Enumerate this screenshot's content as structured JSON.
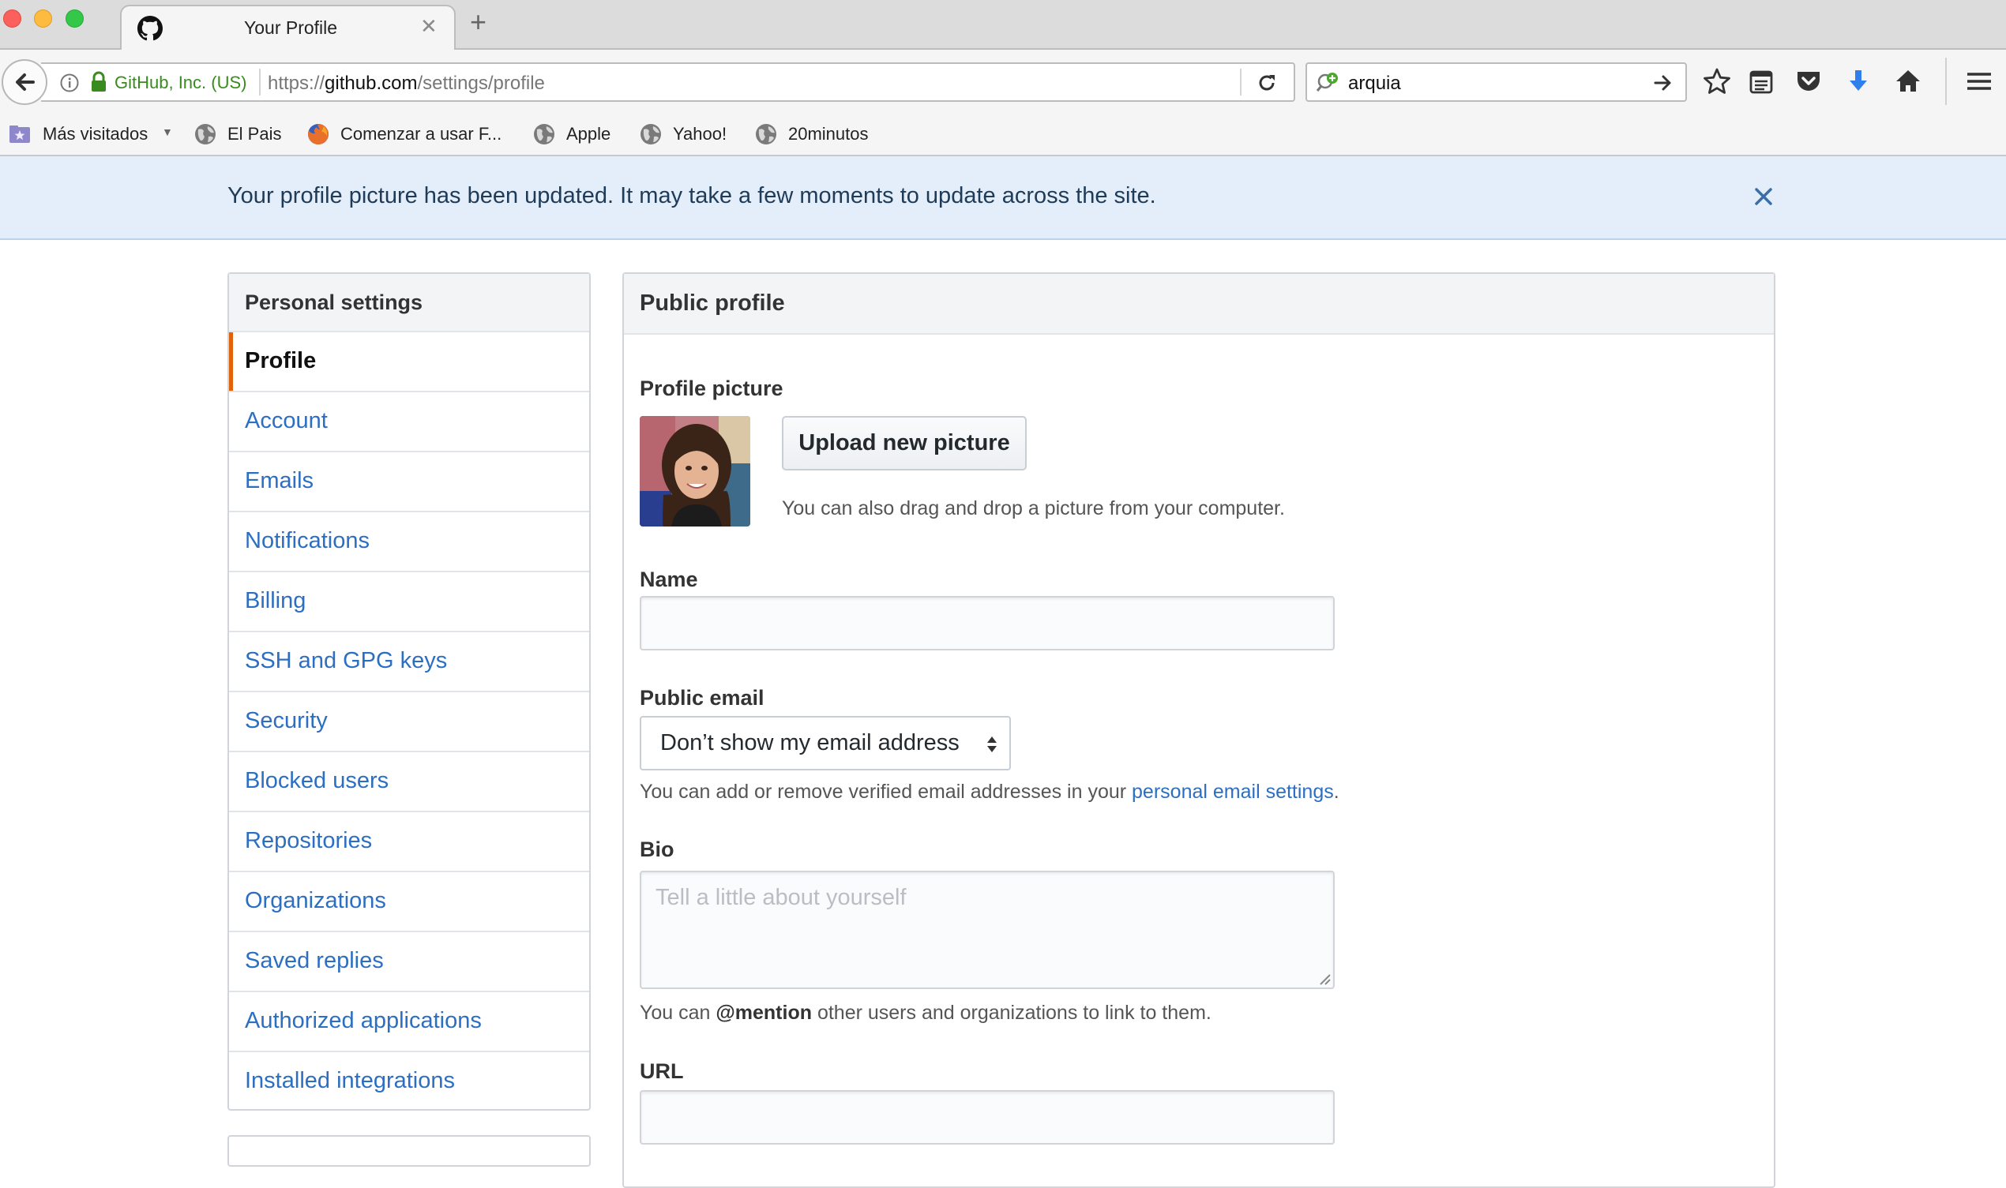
{
  "browser": {
    "tab_title": "Your Profile",
    "identity": "GitHub, Inc. (US)",
    "url_prefix": "https://",
    "url_host": "github.com",
    "url_path": "/settings/profile",
    "search_value": "arquia",
    "bookmarks": [
      {
        "label": "Más visitados",
        "icon": "most-visited-folder-icon"
      },
      {
        "label": "El Pais",
        "icon": "globe-icon"
      },
      {
        "label": "Comenzar a usar F...",
        "icon": "firefox-icon"
      },
      {
        "label": "Apple",
        "icon": "globe-icon"
      },
      {
        "label": "Yahoo!",
        "icon": "globe-icon"
      },
      {
        "label": "20minutos",
        "icon": "globe-icon"
      }
    ]
  },
  "flash": {
    "message": "Your profile picture has been updated. It may take a few moments to update across the site."
  },
  "sidebar": {
    "header": "Personal settings",
    "items": [
      {
        "label": "Profile",
        "selected": true
      },
      {
        "label": "Account"
      },
      {
        "label": "Emails"
      },
      {
        "label": "Notifications"
      },
      {
        "label": "Billing"
      },
      {
        "label": "SSH and GPG keys"
      },
      {
        "label": "Security"
      },
      {
        "label": "Blocked users"
      },
      {
        "label": "Repositories"
      },
      {
        "label": "Organizations"
      },
      {
        "label": "Saved replies"
      },
      {
        "label": "Authorized applications"
      },
      {
        "label": "Installed integrations"
      }
    ]
  },
  "profile": {
    "header": "Public profile",
    "picture_label": "Profile picture",
    "upload_button": "Upload new picture",
    "upload_note": "You can also drag and drop a picture from your computer.",
    "name_label": "Name",
    "name_value": "",
    "email_label": "Public email",
    "email_selected": "Don’t show my email address",
    "email_note_prefix": "You can add or remove verified email addresses in your ",
    "email_note_link": "personal email settings",
    "email_note_suffix": ".",
    "bio_label": "Bio",
    "bio_placeholder": "Tell a little about yourself",
    "bio_note_prefix": "You can ",
    "bio_note_mention": "@mention",
    "bio_note_suffix": " other users and organizations to link to them.",
    "url_label": "URL",
    "url_value": ""
  },
  "colors": {
    "link": "#2c6fc2",
    "selected_accent": "#e36209",
    "flash_bg": "#e3eefa",
    "secure_green": "#3a8b1f"
  }
}
